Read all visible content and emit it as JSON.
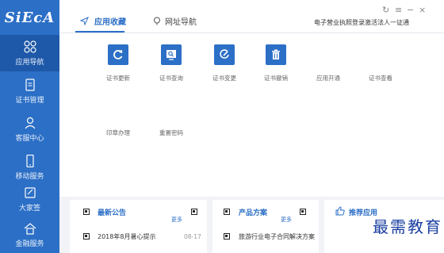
{
  "sidebar": {
    "logo": "SiEcA",
    "items": [
      {
        "label": "应用导航",
        "icon": "grid-icon"
      },
      {
        "label": "证书管理",
        "icon": "certificate-icon"
      },
      {
        "label": "客服中心",
        "icon": "user-icon"
      },
      {
        "label": "移动服务",
        "icon": "phone-icon"
      },
      {
        "label": "大家签",
        "icon": "sign-icon"
      },
      {
        "label": "金融服务",
        "icon": "home-icon"
      }
    ]
  },
  "tabs": [
    {
      "label": "应用收藏",
      "icon": "send-icon"
    },
    {
      "label": "网址导航",
      "icon": "location-icon"
    }
  ],
  "header_links": [
    "电子营业执照登录",
    "激活法人一证通"
  ],
  "window_controls": [
    "↻",
    "≡",
    "−",
    "×"
  ],
  "apps": [
    {
      "label": "证书更新",
      "icon": "refresh-icon"
    },
    {
      "label": "证书查询",
      "icon": "search-icon"
    },
    {
      "label": "证书变更",
      "icon": "edit-icon"
    },
    {
      "label": "证书撤销",
      "icon": "trash-icon"
    },
    {
      "label": "应用开通",
      "icon": ""
    },
    {
      "label": "证书查看",
      "icon": ""
    },
    {
      "label": "印章办理",
      "icon": ""
    },
    {
      "label": "重置密码",
      "icon": ""
    }
  ],
  "panels": {
    "announcements": {
      "title": "最新公告",
      "more": "更多",
      "items": [
        {
          "text": "2018年8月暑心提示",
          "date": "08-17"
        }
      ]
    },
    "products": {
      "title": "产品方案",
      "more": "更多",
      "items": [
        {
          "text": "旅游行业电子合同解决方案"
        }
      ]
    },
    "recommend": {
      "title": "推荐应用",
      "icon": "thumbs-up-icon"
    }
  },
  "watermark": "最需教育",
  "colors": {
    "brand": "#2c6fc6",
    "sidebar_active": "#1e58a8"
  }
}
